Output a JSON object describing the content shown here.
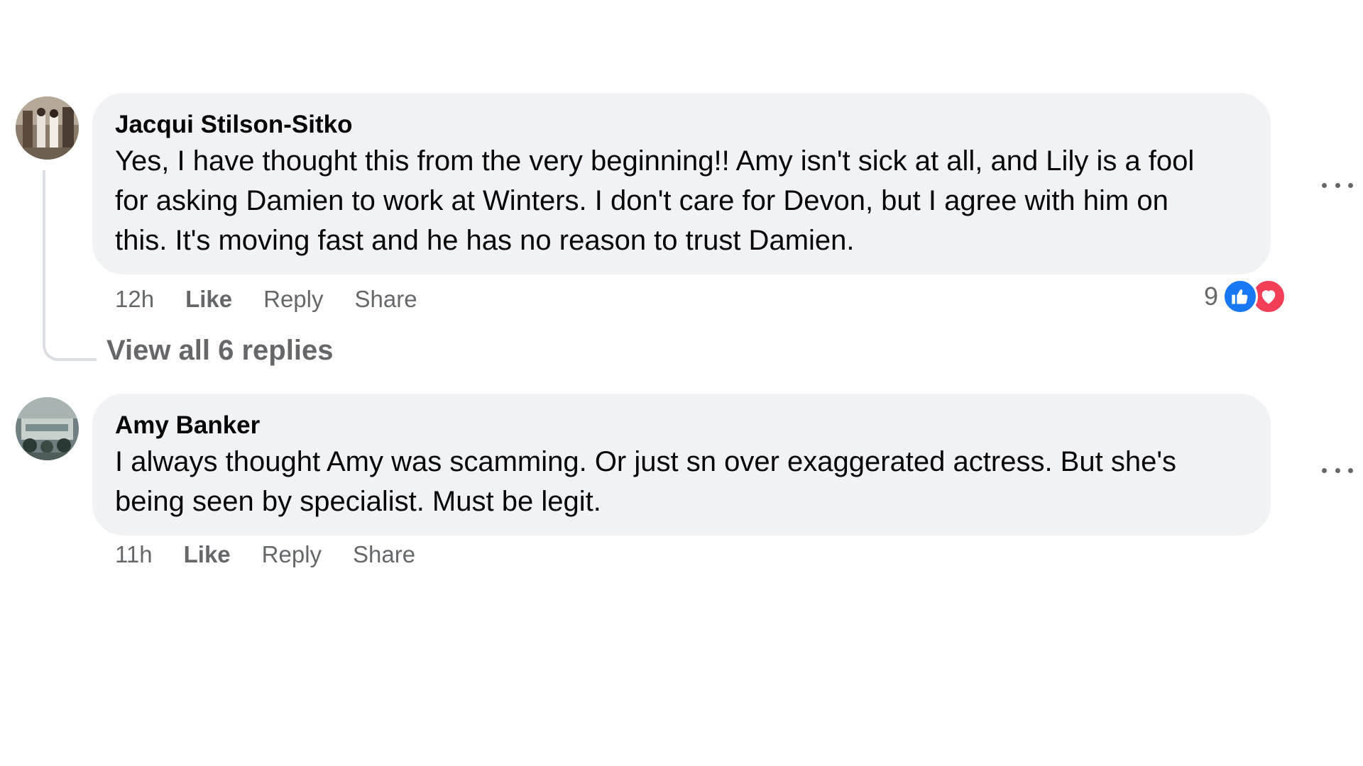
{
  "comments": [
    {
      "author": "Jacqui Stilson-Sitko",
      "text_lines": [
        "Yes, I have thought this from the very beginning!! Amy isn't sick at all, and Lily is a fool",
        "for asking Damien to work at Winters. I don't care for Devon, but I agree with him on",
        "this. It's moving fast and he has no reason to trust Damien."
      ],
      "time": "12h",
      "actions": {
        "like": "Like",
        "reply": "Reply",
        "share": "Share"
      },
      "reaction_count": "9",
      "reaction_icons": [
        "like-icon",
        "love-icon"
      ],
      "view_replies": "View all 6 replies"
    },
    {
      "author": "Amy Banker",
      "text_lines": [
        "I always thought Amy was scamming. Or just sn over exaggerated actress. But she's",
        "being seen by specialist. Must be legit."
      ],
      "time": "11h",
      "actions": {
        "like": "Like",
        "reply": "Reply",
        "share": "Share"
      }
    }
  ],
  "colors": {
    "bubble": "#f0f2f5",
    "secondary_text": "#65676b",
    "like_blue": "#1877f2",
    "love_red": "#f33e58"
  }
}
